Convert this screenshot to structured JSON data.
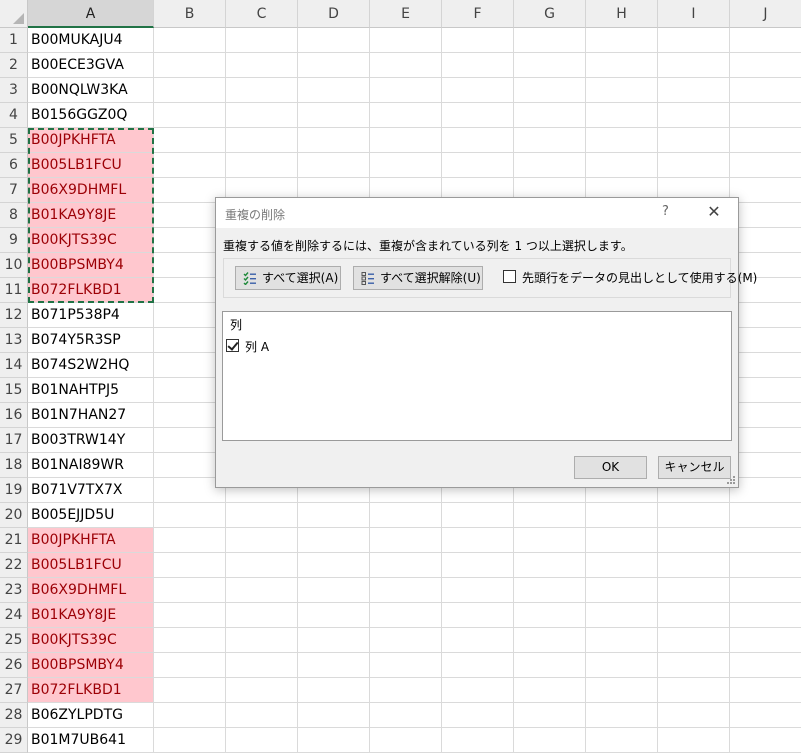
{
  "sheet": {
    "columns": [
      "A",
      "B",
      "C",
      "D",
      "E",
      "F",
      "G",
      "H",
      "I",
      "J"
    ],
    "active_column": "A",
    "highlight_color": "#ffc7ce",
    "highlight_text_color": "#9c0006",
    "rows": [
      {
        "num": "1",
        "value": "B00MUKAJU4",
        "dup": false
      },
      {
        "num": "2",
        "value": "B00ECE3GVA",
        "dup": false
      },
      {
        "num": "3",
        "value": "B00NQLW3KA",
        "dup": false
      },
      {
        "num": "4",
        "value": "B0156GGZ0Q",
        "dup": false
      },
      {
        "num": "5",
        "value": "B00JPKHFTA",
        "dup": true
      },
      {
        "num": "6",
        "value": "B005LB1FCU",
        "dup": true
      },
      {
        "num": "7",
        "value": "B06X9DHMFL",
        "dup": true
      },
      {
        "num": "8",
        "value": "B01KA9Y8JE",
        "dup": true
      },
      {
        "num": "9",
        "value": "B00KJTS39C",
        "dup": true
      },
      {
        "num": "10",
        "value": "B00BPSMBY4",
        "dup": true
      },
      {
        "num": "11",
        "value": "B072FLKBD1",
        "dup": true
      },
      {
        "num": "12",
        "value": "B071P538P4",
        "dup": false
      },
      {
        "num": "13",
        "value": "B074Y5R3SP",
        "dup": false
      },
      {
        "num": "14",
        "value": "B074S2W2HQ",
        "dup": false
      },
      {
        "num": "15",
        "value": "B01NAHTPJ5",
        "dup": false
      },
      {
        "num": "16",
        "value": "B01N7HAN27",
        "dup": false
      },
      {
        "num": "17",
        "value": "B003TRW14Y",
        "dup": false
      },
      {
        "num": "18",
        "value": "B01NAI89WR",
        "dup": false
      },
      {
        "num": "19",
        "value": "B071V7TX7X",
        "dup": false
      },
      {
        "num": "20",
        "value": "B005EJJD5U",
        "dup": false
      },
      {
        "num": "21",
        "value": "B00JPKHFTA",
        "dup": true
      },
      {
        "num": "22",
        "value": "B005LB1FCU",
        "dup": true
      },
      {
        "num": "23",
        "value": "B06X9DHMFL",
        "dup": true
      },
      {
        "num": "24",
        "value": "B01KA9Y8JE",
        "dup": true
      },
      {
        "num": "25",
        "value": "B00KJTS39C",
        "dup": true
      },
      {
        "num": "26",
        "value": "B00BPSMBY4",
        "dup": true
      },
      {
        "num": "27",
        "value": "B072FLKBD1",
        "dup": true
      },
      {
        "num": "28",
        "value": "B06ZYLPDTG",
        "dup": false
      },
      {
        "num": "29",
        "value": "B01M7UB641",
        "dup": false
      }
    ]
  },
  "dialog": {
    "title": "重複の削除",
    "help_label": "?",
    "close_label": "✕",
    "instruction": "重複する値を削除するには、重複が含まれている列を 1 つ以上選択します。",
    "select_all_label": "すべて選択(A)",
    "unselect_all_label": "すべて選択解除(U)",
    "header_checkbox_label": "先頭行をデータの見出しとして使用する(M)",
    "header_checkbox_checked": false,
    "list_header": "列",
    "columns": [
      {
        "label": "列 A",
        "checked": true
      }
    ],
    "ok_label": "OK",
    "cancel_label": "キャンセル"
  }
}
